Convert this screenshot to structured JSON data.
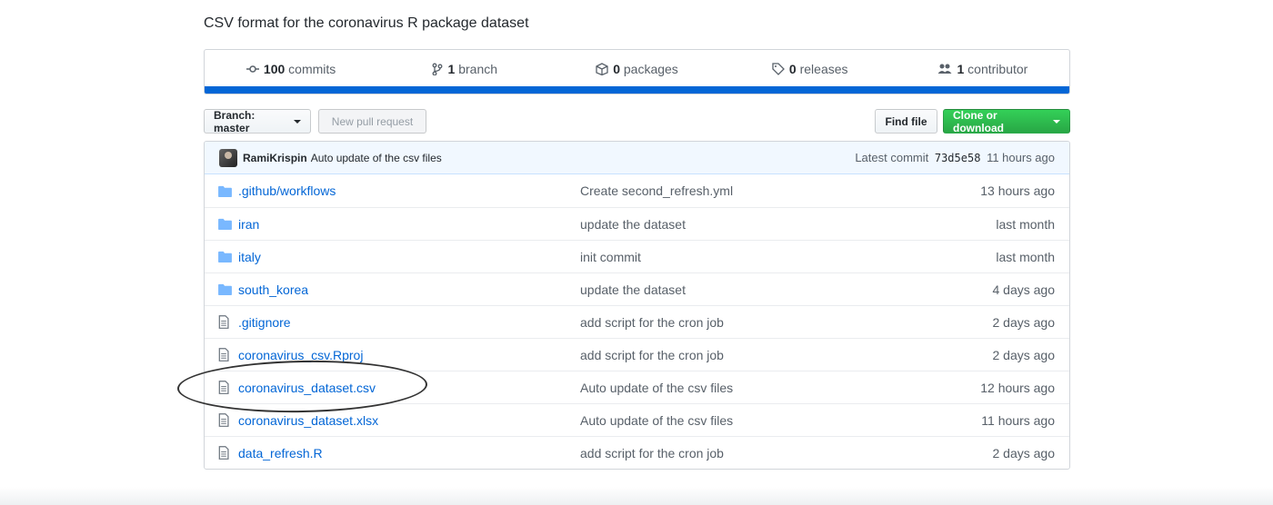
{
  "repo": {
    "description": "CSV format for the coronavirus R package dataset"
  },
  "summary": {
    "commits_count": "100",
    "commits_label": "commits",
    "branch_count": "1",
    "branch_label": "branch",
    "packages_count": "0",
    "packages_label": "packages",
    "releases_count": "0",
    "releases_label": "releases",
    "contributor_count": "1",
    "contributor_label": "contributor",
    "language_bar_color": "#0366d6"
  },
  "toolbar": {
    "branch_label": "Branch: master",
    "new_pr_label": "New pull request",
    "find_file_label": "Find file",
    "clone_label": "Clone or download"
  },
  "latest_commit": {
    "author": "RamiKrispin",
    "message": "Auto update of the csv files",
    "prefix": "Latest commit",
    "sha": "73d5e58",
    "age": "11 hours ago"
  },
  "files": [
    {
      "type": "dir",
      "name": ".github/workflows",
      "message": "Create second_refresh.yml",
      "age": "13 hours ago"
    },
    {
      "type": "dir",
      "name": "iran",
      "message": "update the dataset",
      "age": "last month"
    },
    {
      "type": "dir",
      "name": "italy",
      "message": "init commit",
      "age": "last month"
    },
    {
      "type": "dir",
      "name": "south_korea",
      "message": "update the dataset",
      "age": "4 days ago"
    },
    {
      "type": "file",
      "name": ".gitignore",
      "message": "add script for the cron job",
      "age": "2 days ago"
    },
    {
      "type": "file",
      "name": "coronavirus_csv.Rproj",
      "message": "add script for the cron job",
      "age": "2 days ago"
    },
    {
      "type": "file",
      "name": "coronavirus_dataset.csv",
      "message": "Auto update of the csv files",
      "age": "12 hours ago"
    },
    {
      "type": "file",
      "name": "coronavirus_dataset.xlsx",
      "message": "Auto update of the csv files",
      "age": "11 hours ago"
    },
    {
      "type": "file",
      "name": "data_refresh.R",
      "message": "add script for the cron job",
      "age": "2 days ago"
    }
  ]
}
